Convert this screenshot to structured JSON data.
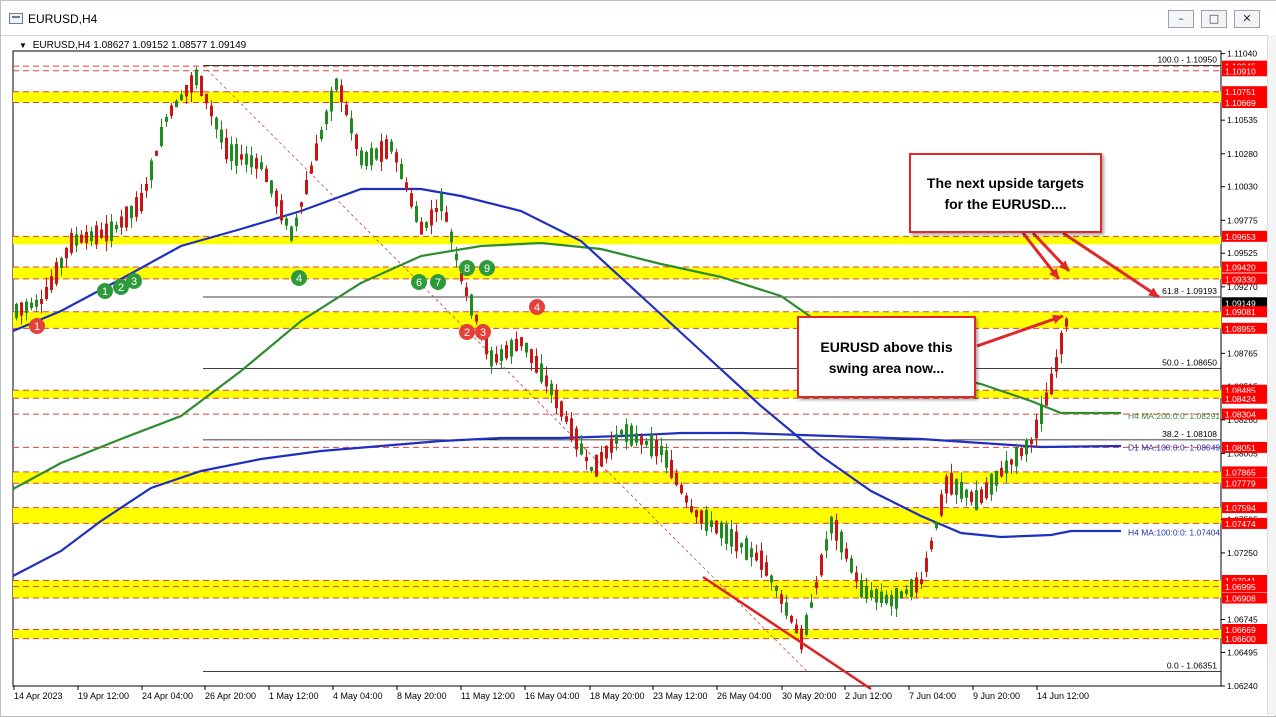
{
  "window": {
    "title": "EURUSD,H4",
    "buttons": {
      "minimize": "–",
      "maximize": "□",
      "close": "✕"
    }
  },
  "chart_header": {
    "symbol": "EURUSD,H4",
    "ohlc": "1.08627 1.09152 1.08577 1.09149"
  },
  "price_axis": {
    "min": 1.0624,
    "max": 1.1106,
    "ticks": [
      "1.11040",
      "1.10535",
      "1.10280",
      "1.10030",
      "1.09775",
      "1.09525",
      "1.09270",
      "1.08765",
      "1.08515",
      "1.08260",
      "1.08005",
      "1.07505",
      "1.07250",
      "1.06745",
      "1.06495",
      "1.06240"
    ]
  },
  "time_axis": {
    "labels": [
      "14 Apr 2023",
      "19 Apr 12:00",
      "24 Apr 04:00",
      "26 Apr 20:00",
      "1 May 12:00",
      "4 May 04:00",
      "8 May 20:00",
      "11 May 12:00",
      "16 May 04:00",
      "18 May 20:00",
      "23 May 12:00",
      "26 May 04:00",
      "30 May 20:00",
      "2 Jun 12:00",
      "7 Jun 04:00",
      "9 Jun 20:00",
      "14 Jun 12:00"
    ]
  },
  "price_labels": [
    {
      "text": "1.10945",
      "value": 1.10945,
      "color": "#ff0000"
    },
    {
      "text": "1.10910",
      "value": 1.1091,
      "color": "#ff0000"
    },
    {
      "text": "1.10751",
      "value": 1.10751,
      "color": "#ff0000"
    },
    {
      "text": "1.10669",
      "value": 1.10669,
      "color": "#ff0000"
    },
    {
      "text": "1.09653",
      "value": 1.09653,
      "color": "#ff0000"
    },
    {
      "text": "1.09420",
      "value": 1.0942,
      "color": "#ff0000"
    },
    {
      "text": "1.09330",
      "value": 1.0933,
      "color": "#ff0000"
    },
    {
      "text": "1.09149",
      "value": 1.09149,
      "color": "#000000"
    },
    {
      "text": "1.09081",
      "value": 1.09081,
      "color": "#ff0000"
    },
    {
      "text": "1.08955",
      "value": 1.08955,
      "color": "#ff0000"
    },
    {
      "text": "1.08485",
      "value": 1.08485,
      "color": "#ff0000"
    },
    {
      "text": "1.08424",
      "value": 1.08424,
      "color": "#ff0000"
    },
    {
      "text": "1.08304",
      "value": 1.08304,
      "color": "#ff0000"
    },
    {
      "text": "1.08051",
      "value": 1.08051,
      "color": "#ff0000"
    },
    {
      "text": "1.07865",
      "value": 1.07865,
      "color": "#ff0000"
    },
    {
      "text": "1.07779",
      "value": 1.07779,
      "color": "#ff0000"
    },
    {
      "text": "1.07594",
      "value": 1.07594,
      "color": "#ff0000"
    },
    {
      "text": "1.07474",
      "value": 1.07474,
      "color": "#ff0000"
    },
    {
      "text": "1.07041",
      "value": 1.07041,
      "color": "#ff0000"
    },
    {
      "text": "1.06995",
      "value": 1.06995,
      "color": "#ff0000"
    },
    {
      "text": "1.06908",
      "value": 1.06908,
      "color": "#ff0000"
    },
    {
      "text": "1.06669",
      "value": 1.06669,
      "color": "#ff0000"
    },
    {
      "text": "1.06600",
      "value": 1.066,
      "color": "#ff0000"
    }
  ],
  "zones": [
    {
      "low": 1.10669,
      "high": 1.10751
    },
    {
      "low": 1.09593,
      "high": 1.09653
    },
    {
      "low": 1.0933,
      "high": 1.0942
    },
    {
      "low": 1.08955,
      "high": 1.09081
    },
    {
      "low": 1.08424,
      "high": 1.08485
    },
    {
      "low": 1.07779,
      "high": 1.07865
    },
    {
      "low": 1.07474,
      "high": 1.07594
    },
    {
      "low": 1.06908,
      "high": 1.07041
    },
    {
      "low": 1.066,
      "high": 1.06669
    }
  ],
  "fib_levels": [
    {
      "label": "100.0 - 1.10950",
      "value": 1.1095
    },
    {
      "label": "61.8 - 1.09193",
      "value": 1.09193
    },
    {
      "label": "50.0 - 1.08650",
      "value": 1.0865
    },
    {
      "label": "38.2 - 1.08108",
      "value": 1.08108
    },
    {
      "label": "0.0 - 1.06351",
      "value": 1.06351
    }
  ],
  "ma_labels": [
    {
      "text": "H4 MA:200:0:0: 1.08291",
      "value": 1.08291,
      "color": "#3a8a3a"
    },
    {
      "text": "D1 MA:100:0:0: 1.08049",
      "value": 1.08049,
      "color": "#2233aa"
    },
    {
      "text": "H4 MA:100:0:0: 1.07404",
      "value": 1.07404,
      "color": "#2233aa"
    }
  ],
  "markers": [
    {
      "label": "1",
      "color": "#e5413b"
    },
    {
      "label": "1",
      "color": "#2e9a3c"
    },
    {
      "label": "2",
      "color": "#2e9a3c"
    },
    {
      "label": "3",
      "color": "#2e9a3c"
    },
    {
      "label": "4",
      "color": "#2e9a3c"
    },
    {
      "label": "6",
      "color": "#2e9a3c"
    },
    {
      "label": "7",
      "color": "#2e9a3c"
    },
    {
      "label": "8",
      "color": "#2e9a3c"
    },
    {
      "label": "9",
      "color": "#2e9a3c"
    },
    {
      "label": "2",
      "color": "#e5413b"
    },
    {
      "label": "3",
      "color": "#e5413b"
    },
    {
      "label": "4",
      "color": "#e5413b"
    }
  ],
  "annotations": {
    "targets": [
      "The next upside targets",
      "for the EURUSD...."
    ],
    "swing": [
      "EURUSD above this",
      "swing area now..."
    ]
  },
  "colors": {
    "zone_fill": "#ffff00",
    "bull": "#1e8c1e",
    "bear": "#cc1414",
    "ma_h4_200": "#2e8b2e",
    "ma_h4_100": "#1f2fbf",
    "ma_d1_100": "#1f2fbf",
    "annotation_border": "#e0282a"
  }
}
